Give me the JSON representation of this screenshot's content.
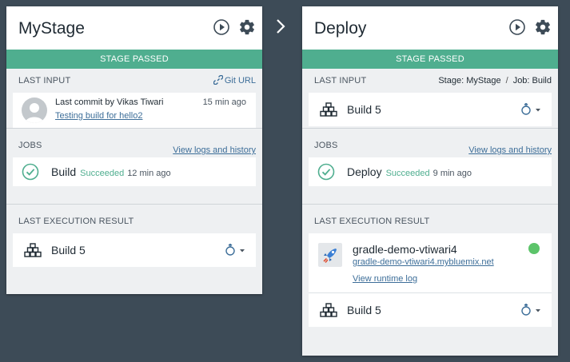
{
  "stages": [
    {
      "title": "MyStage",
      "status": "STAGE PASSED",
      "last_input": {
        "section_title": "LAST INPUT",
        "link_label": "Git URL",
        "commit_text": "Last commit by Vikas Tiwari",
        "commit_time": "15 min ago",
        "commit_message": "Testing build for hello2"
      },
      "jobs": {
        "section_title": "JOBS",
        "link_label": "View logs and history",
        "job_name": "Build",
        "job_status": "Succeeded",
        "job_time": "12 min ago"
      },
      "last_execution": {
        "section_title": "LAST EXECUTION RESULT",
        "build_label": "Build 5"
      }
    },
    {
      "title": "Deploy",
      "status": "STAGE PASSED",
      "last_input": {
        "section_title": "LAST INPUT",
        "stage_label": "Stage: MyStage",
        "separator": "/",
        "job_label": "Job: Build",
        "build_label": "Build 5"
      },
      "jobs": {
        "section_title": "JOBS",
        "link_label": "View logs and history",
        "job_name": "Deploy",
        "job_status": "Succeeded",
        "job_time": "9 min ago"
      },
      "last_execution": {
        "section_title": "LAST EXECUTION RESULT",
        "app_name": "gradle-demo-vtiwari4",
        "app_url": "gradle-demo-vtiwari4.mybluemix.net",
        "runtime_log_label": "View runtime log",
        "build_label": "Build 5"
      }
    }
  ],
  "colors": {
    "background": "#3d4b57",
    "stage_passed": "#4fae8f",
    "link": "#3d6e99",
    "app_running": "#5cc46a"
  },
  "icons": [
    "play-icon",
    "gear-icon",
    "link-icon",
    "avatar-icon",
    "check-circle-icon",
    "blocks-icon",
    "rocket-icon",
    "chevron-right-icon",
    "caret-down-icon"
  ]
}
